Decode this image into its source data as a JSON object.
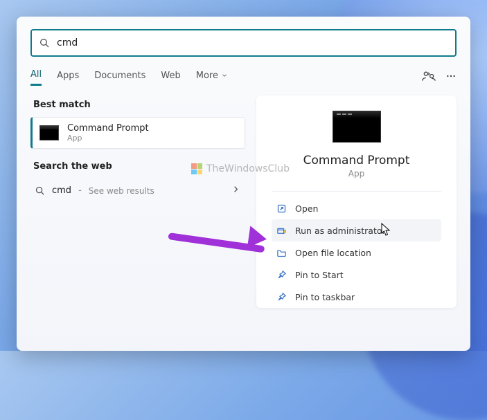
{
  "search": {
    "query": "cmd"
  },
  "tabs": {
    "items": [
      "All",
      "Apps",
      "Documents",
      "Web",
      "More"
    ],
    "active_index": 0
  },
  "best_match": {
    "section_label": "Best match",
    "title": "Command Prompt",
    "subtitle": "App"
  },
  "search_web": {
    "section_label": "Search the web",
    "term": "cmd",
    "hint": "See web results"
  },
  "details": {
    "title": "Command Prompt",
    "subtitle": "App",
    "actions": [
      {
        "id": "open",
        "label": "Open"
      },
      {
        "id": "run-admin",
        "label": "Run as administrator"
      },
      {
        "id": "open-file-location",
        "label": "Open file location"
      },
      {
        "id": "pin-start",
        "label": "Pin to Start"
      },
      {
        "id": "pin-taskbar",
        "label": "Pin to taskbar"
      }
    ],
    "hovered_action_index": 1
  },
  "watermark": "TheWindowsClub"
}
